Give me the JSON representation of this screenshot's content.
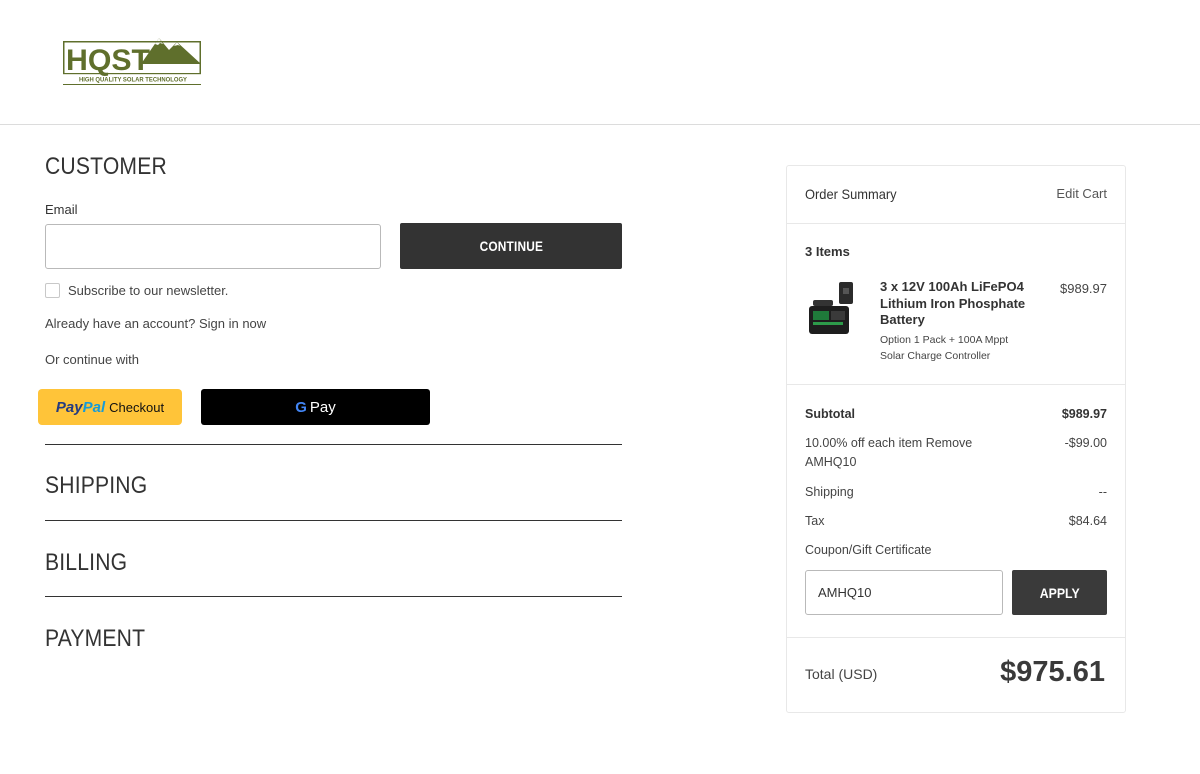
{
  "brand": {
    "name": "HQST",
    "tagline": "HIGH QUALITY SOLAR TECHNOLOGY",
    "color": "#5f6f2c"
  },
  "customer": {
    "title": "CUSTOMER",
    "email_label": "Email",
    "email_value": "",
    "continue_label": "CONTINUE",
    "newsletter_label": "Subscribe to our newsletter.",
    "account_text": "Already have an account?",
    "sign_in_label": "Sign in now",
    "or_continue": "Or continue with",
    "paypal": {
      "brand_part1": "Pay",
      "brand_part2": "Pal",
      "label": "Checkout",
      "color": "#ffc439"
    },
    "gpay": {
      "g": "G",
      "label": "Pay"
    }
  },
  "sections": {
    "shipping": "SHIPPING",
    "billing": "BILLING",
    "payment": "PAYMENT"
  },
  "summary": {
    "title": "Order Summary",
    "edit_cart": "Edit Cart",
    "items_count": "3 Items",
    "product": {
      "name": "3 x 12V 100Ah LiFePO4 Lithium Iron Phosphate Battery",
      "option": "Option 1 Pack + 100A Mppt Solar Charge Controller",
      "price": "$989.97"
    },
    "subtotal_label": "Subtotal",
    "subtotal_value": "$989.97",
    "discount_text": "10.00% off each item",
    "discount_remove": "Remove",
    "discount_code": "AMHQ10",
    "discount_value": "-$99.00",
    "shipping_label": "Shipping",
    "shipping_value": "--",
    "tax_label": "Tax",
    "tax_value": "$84.64",
    "coupon_label": "Coupon/Gift Certificate",
    "coupon_value": "AMHQ10",
    "apply_label": "APPLY",
    "total_label": "Total (USD)",
    "total_value": "$975.61"
  }
}
